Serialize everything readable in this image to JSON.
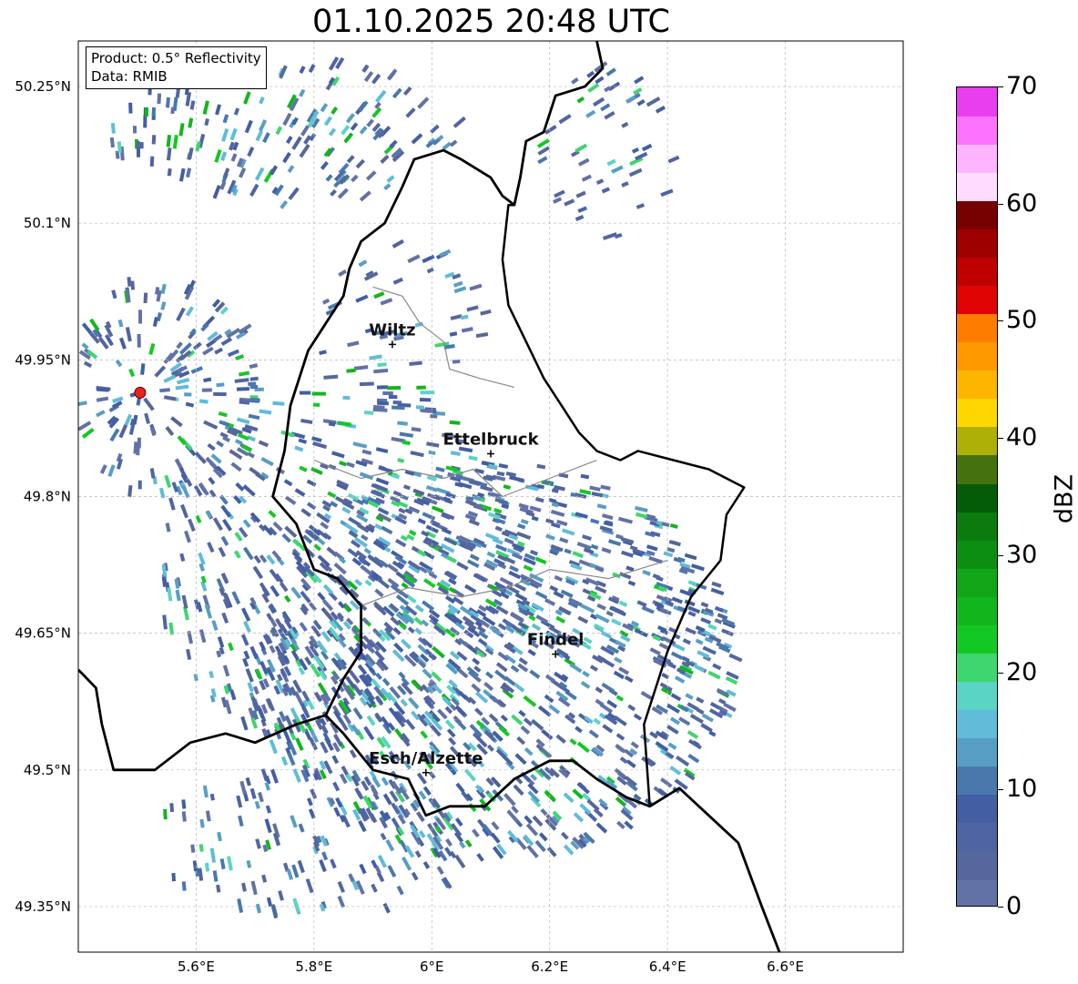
{
  "title": "01.10.2025 20:48 UTC",
  "info": {
    "product": "Product: 0.5° Reflectivity",
    "data_source": "Data: RMIB"
  },
  "map": {
    "lon_range": [
      5.4,
      6.8
    ],
    "lat_range": [
      49.3,
      50.3
    ],
    "x_ticks": [
      {
        "value": 5.6,
        "label": "5.6°E"
      },
      {
        "value": 5.8,
        "label": "5.8°E"
      },
      {
        "value": 6.0,
        "label": "6°E"
      },
      {
        "value": 6.2,
        "label": "6.2°E"
      },
      {
        "value": 6.4,
        "label": "6.4°E"
      },
      {
        "value": 6.6,
        "label": "6.6°E"
      }
    ],
    "y_ticks": [
      {
        "value": 50.25,
        "label": "50.25°N"
      },
      {
        "value": 50.1,
        "label": "50.1°N"
      },
      {
        "value": 49.95,
        "label": "49.95°N"
      },
      {
        "value": 49.8,
        "label": "49.8°N"
      },
      {
        "value": 49.65,
        "label": "49.65°N"
      },
      {
        "value": 49.5,
        "label": "49.5°N"
      },
      {
        "value": 49.35,
        "label": "49.35°N"
      }
    ],
    "radar_site": {
      "lon": 5.505,
      "lat": 49.914,
      "color": "#e8231c"
    },
    "cities": [
      {
        "name": "Wiltz",
        "lon": 5.933,
        "lat": 49.967
      },
      {
        "name": "Ettelbruck",
        "lon": 6.1,
        "lat": 49.847
      },
      {
        "name": "Findel",
        "lon": 6.21,
        "lat": 49.627
      },
      {
        "name": "Esch/Alzette",
        "lon": 5.99,
        "lat": 49.497
      }
    ],
    "borders": {
      "national": [
        [
          [
            6.28,
            50.3
          ],
          [
            6.29,
            50.27
          ],
          [
            6.26,
            50.25
          ],
          [
            6.21,
            50.24
          ],
          [
            6.19,
            50.2
          ],
          [
            6.16,
            50.19
          ],
          [
            6.15,
            50.15
          ],
          [
            6.14,
            50.12
          ],
          [
            6.12,
            50.13
          ],
          [
            6.1,
            50.15
          ],
          [
            6.05,
            50.17
          ],
          [
            6.02,
            50.18
          ],
          [
            5.97,
            50.17
          ],
          [
            5.95,
            50.14
          ],
          [
            5.92,
            50.1
          ],
          [
            5.88,
            50.08
          ],
          [
            5.86,
            50.05
          ],
          [
            5.85,
            50.02
          ],
          [
            5.82,
            49.99
          ],
          [
            5.79,
            49.96
          ],
          [
            5.76,
            49.9
          ],
          [
            5.75,
            49.85
          ],
          [
            5.73,
            49.8
          ],
          [
            5.77,
            49.77
          ],
          [
            5.8,
            49.72
          ],
          [
            5.84,
            49.71
          ],
          [
            5.88,
            49.68
          ],
          [
            5.88,
            49.63
          ],
          [
            5.85,
            49.6
          ],
          [
            5.82,
            49.56
          ],
          [
            5.85,
            49.54
          ],
          [
            5.9,
            49.5
          ],
          [
            5.96,
            49.49
          ],
          [
            5.99,
            49.45
          ],
          [
            6.03,
            49.46
          ],
          [
            6.09,
            49.46
          ],
          [
            6.14,
            49.49
          ],
          [
            6.2,
            49.51
          ],
          [
            6.24,
            49.51
          ],
          [
            6.28,
            49.49
          ],
          [
            6.33,
            49.47
          ],
          [
            6.37,
            49.46
          ],
          [
            6.42,
            49.48
          ],
          [
            6.47,
            49.45
          ],
          [
            6.52,
            49.42
          ],
          [
            6.56,
            49.35
          ],
          [
            6.59,
            49.3
          ]
        ],
        [
          [
            5.4,
            49.61
          ],
          [
            5.43,
            49.59
          ],
          [
            5.44,
            49.55
          ],
          [
            5.46,
            49.5
          ],
          [
            5.53,
            49.5
          ],
          [
            5.59,
            49.53
          ],
          [
            5.65,
            49.54
          ],
          [
            5.7,
            49.53
          ],
          [
            5.77,
            49.55
          ],
          [
            5.82,
            49.56
          ]
        ]
      ],
      "regional": [
        [
          [
            6.37,
            49.46
          ],
          [
            6.36,
            49.55
          ],
          [
            6.4,
            49.63
          ],
          [
            6.44,
            49.69
          ],
          [
            6.49,
            49.73
          ],
          [
            6.5,
            49.78
          ],
          [
            6.53,
            49.81
          ],
          [
            6.47,
            49.83
          ],
          [
            6.41,
            49.84
          ],
          [
            6.35,
            49.85
          ],
          [
            6.32,
            49.84
          ],
          [
            6.28,
            49.85
          ],
          [
            6.25,
            49.87
          ],
          [
            6.22,
            49.9
          ],
          [
            6.19,
            49.93
          ],
          [
            6.16,
            49.97
          ],
          [
            6.13,
            50.01
          ],
          [
            6.12,
            50.06
          ],
          [
            6.13,
            50.12
          ],
          [
            6.14,
            50.12
          ]
        ]
      ],
      "canton": [
        [
          [
            5.9,
            50.03
          ],
          [
            5.95,
            50.02
          ],
          [
            5.98,
            49.99
          ],
          [
            6.02,
            49.97
          ],
          [
            6.03,
            49.94
          ],
          [
            6.08,
            49.93
          ],
          [
            6.14,
            49.92
          ]
        ],
        [
          [
            5.8,
            49.84
          ],
          [
            5.88,
            49.82
          ],
          [
            5.95,
            49.83
          ],
          [
            6.02,
            49.82
          ],
          [
            6.07,
            49.83
          ],
          [
            6.12,
            49.8
          ],
          [
            6.2,
            49.82
          ],
          [
            6.28,
            49.84
          ]
        ],
        [
          [
            5.88,
            49.68
          ],
          [
            5.96,
            49.7
          ],
          [
            6.05,
            49.69
          ],
          [
            6.13,
            49.7
          ],
          [
            6.2,
            49.72
          ],
          [
            6.3,
            49.71
          ],
          [
            6.4,
            49.73
          ]
        ]
      ]
    },
    "echo_regions": [
      {
        "lon": 6.1,
        "lat": 49.62,
        "rx": 0.42,
        "ry": 0.22,
        "density": 0.85
      },
      {
        "lon": 5.85,
        "lat": 49.72,
        "rx": 0.32,
        "ry": 0.2,
        "density": 0.55
      },
      {
        "lon": 5.75,
        "lat": 50.2,
        "rx": 0.3,
        "ry": 0.08,
        "density": 0.5
      },
      {
        "lon": 5.55,
        "lat": 49.92,
        "rx": 0.16,
        "ry": 0.13,
        "density": 0.6
      },
      {
        "lon": 6.3,
        "lat": 50.18,
        "rx": 0.12,
        "ry": 0.1,
        "density": 0.3
      },
      {
        "lon": 5.95,
        "lat": 49.98,
        "rx": 0.15,
        "ry": 0.1,
        "density": 0.3
      },
      {
        "lon": 5.8,
        "lat": 49.42,
        "rx": 0.28,
        "ry": 0.08,
        "density": 0.4
      }
    ]
  },
  "colorbar": {
    "label": "dBZ",
    "min": 0,
    "max": 70,
    "ticks": [
      {
        "value": 0,
        "label": "0"
      },
      {
        "value": 10,
        "label": "10"
      },
      {
        "value": 20,
        "label": "20"
      },
      {
        "value": 30,
        "label": "30"
      },
      {
        "value": 40,
        "label": "40"
      },
      {
        "value": 50,
        "label": "50"
      },
      {
        "value": 60,
        "label": "60"
      },
      {
        "value": 70,
        "label": "70"
      }
    ],
    "colors": [
      "#6272a6",
      "#56679d",
      "#4f64a3",
      "#435ea2",
      "#4a78ad",
      "#589ec4",
      "#60bcd8",
      "#5ad4c4",
      "#3ed66e",
      "#14c823",
      "#12b61c",
      "#10a617",
      "#0c8e12",
      "#0b7b0f",
      "#045c08",
      "#46720e",
      "#adb006",
      "#fed600",
      "#feb500",
      "#fe9a00",
      "#fe7c00",
      "#e00303",
      "#c00000",
      "#9e0000",
      "#770000",
      "#ffdcff",
      "#feb4fe",
      "#fd73fe",
      "#e93df0"
    ]
  }
}
